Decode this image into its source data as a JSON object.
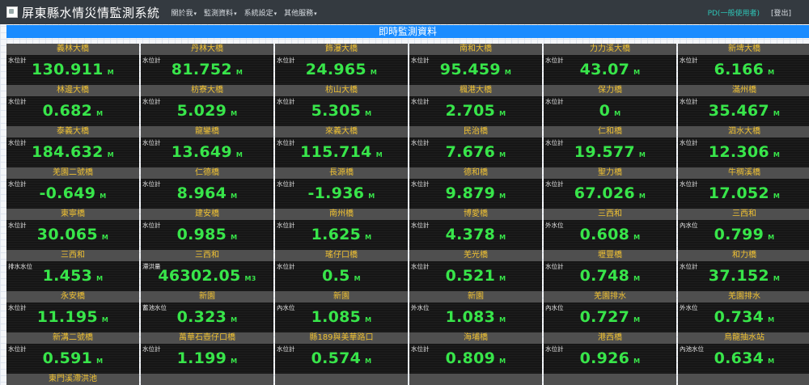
{
  "header": {
    "title": "屏東縣水情災情監測系統",
    "menu": [
      "關於我",
      "監測資料",
      "系統設定",
      "其他服務"
    ],
    "user": "PD(一般使用者)",
    "logout": "[登出]"
  },
  "banner": "即時監測資料",
  "stations": [
    {
      "name": "義林大橋",
      "type": "水位計",
      "value": "130.911",
      "unit": "M"
    },
    {
      "name": "丹林大橋",
      "type": "水位計",
      "value": "81.752",
      "unit": "M"
    },
    {
      "name": "飾瀑大橋",
      "type": "水位計",
      "value": "24.965",
      "unit": "M"
    },
    {
      "name": "南和大橋",
      "type": "水位計",
      "value": "95.459",
      "unit": "M"
    },
    {
      "name": "力力溪大橋",
      "type": "水位計",
      "value": "43.07",
      "unit": "M"
    },
    {
      "name": "新埤大橋",
      "type": "水位計",
      "value": "6.166",
      "unit": "M"
    },
    {
      "name": "林邊大橋",
      "type": "水位計",
      "value": "0.682",
      "unit": "M"
    },
    {
      "name": "枋寮大橋",
      "type": "水位計",
      "value": "5.029",
      "unit": "M"
    },
    {
      "name": "枋山大橋",
      "type": "水位計",
      "value": "5.305",
      "unit": "M"
    },
    {
      "name": "楓港大橋",
      "type": "水位計",
      "value": "2.705",
      "unit": "M"
    },
    {
      "name": "保力橋",
      "type": "水位計",
      "value": "0",
      "unit": "M"
    },
    {
      "name": "滿州橋",
      "type": "水位計",
      "value": "35.467",
      "unit": "M"
    },
    {
      "name": "泰義大橋",
      "type": "水位計",
      "value": "184.632",
      "unit": "M"
    },
    {
      "name": "龍鑾橋",
      "type": "水位計",
      "value": "13.649",
      "unit": "M"
    },
    {
      "name": "來義大橋",
      "type": "水位計",
      "value": "115.714",
      "unit": "M"
    },
    {
      "name": "民治橋",
      "type": "水位計",
      "value": "7.676",
      "unit": "M"
    },
    {
      "name": "仁和橋",
      "type": "水位計",
      "value": "19.577",
      "unit": "M"
    },
    {
      "name": "泗水大橋",
      "type": "水位計",
      "value": "12.306",
      "unit": "M"
    },
    {
      "name": "羌園二號橋",
      "type": "水位計",
      "value": "-0.649",
      "unit": "M"
    },
    {
      "name": "仁德橋",
      "type": "水位計",
      "value": "8.964",
      "unit": "M"
    },
    {
      "name": "長源橋",
      "type": "水位計",
      "value": "-1.936",
      "unit": "M"
    },
    {
      "name": "德和橋",
      "type": "水位計",
      "value": "9.879",
      "unit": "M"
    },
    {
      "name": "聖力橋",
      "type": "水位計",
      "value": "67.026",
      "unit": "M"
    },
    {
      "name": "牛稠溪橋",
      "type": "水位計",
      "value": "17.052",
      "unit": "M"
    },
    {
      "name": "東寧橋",
      "type": "水位計",
      "value": "30.065",
      "unit": "M"
    },
    {
      "name": "建安橋",
      "type": "水位計",
      "value": "0.985",
      "unit": "M"
    },
    {
      "name": "南州橋",
      "type": "水位計",
      "value": "1.625",
      "unit": "M"
    },
    {
      "name": "博愛橋",
      "type": "水位計",
      "value": "4.378",
      "unit": "M"
    },
    {
      "name": "三西和",
      "type": "外水位",
      "value": "0.608",
      "unit": "M"
    },
    {
      "name": "三西和",
      "type": "內水位",
      "value": "0.799",
      "unit": "M"
    },
    {
      "name": "三西和",
      "type": "排水水位",
      "value": "1.453",
      "unit": "M"
    },
    {
      "name": "三西和",
      "type": "滯洪量",
      "value": "46302.05",
      "unit": "M3"
    },
    {
      "name": "瑤仔口橋",
      "type": "水位計",
      "value": "0.5",
      "unit": "M"
    },
    {
      "name": "羌光橋",
      "type": "水位計",
      "value": "0.521",
      "unit": "M"
    },
    {
      "name": "壢豐橋",
      "type": "水位計",
      "value": "0.748",
      "unit": "M"
    },
    {
      "name": "和力橋",
      "type": "水位計",
      "value": "37.152",
      "unit": "M"
    },
    {
      "name": "永安橋",
      "type": "水位計",
      "value": "11.195",
      "unit": "M"
    },
    {
      "name": "新園",
      "type": "蓄池水位",
      "value": "0.323",
      "unit": "M"
    },
    {
      "name": "新園",
      "type": "內水位",
      "value": "1.085",
      "unit": "M"
    },
    {
      "name": "新園",
      "type": "外水位",
      "value": "1.083",
      "unit": "M"
    },
    {
      "name": "羌園排水",
      "type": "內水位",
      "value": "0.727",
      "unit": "M"
    },
    {
      "name": "羌園排水",
      "type": "外水位",
      "value": "0.734",
      "unit": "M"
    },
    {
      "name": "新溝二號橋",
      "type": "水位計",
      "value": "0.591",
      "unit": "M"
    },
    {
      "name": "萬華石壺仔口橋",
      "type": "水位計",
      "value": "1.199",
      "unit": "M"
    },
    {
      "name": "縣189與美華路口",
      "type": "水位計",
      "value": "0.574",
      "unit": "M"
    },
    {
      "name": "海埔橋",
      "type": "水位計",
      "value": "0.809",
      "unit": "M"
    },
    {
      "name": "港西橋",
      "type": "水位計",
      "value": "0.926",
      "unit": "M"
    },
    {
      "name": "烏龍抽水站",
      "type": "內池水位",
      "value": "0.634",
      "unit": "M"
    }
  ],
  "partial_row": [
    {
      "name": "東門溪滯洪池"
    },
    {
      "name": ""
    },
    {
      "name": ""
    },
    {
      "name": ""
    },
    {
      "name": ""
    },
    {
      "name": ""
    }
  ]
}
